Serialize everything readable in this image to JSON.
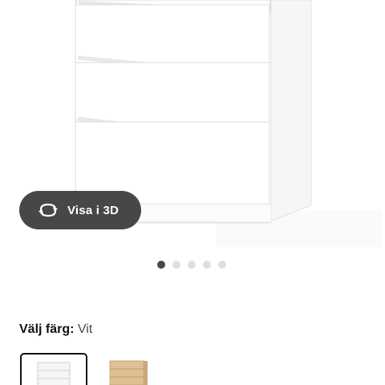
{
  "product": {
    "image_name": "white chest of drawers"
  },
  "view_3d": {
    "label": "Visa i 3D",
    "icon": "rotate-3d-icon"
  },
  "carousel": {
    "count": 5,
    "active_index": 0
  },
  "color_selector": {
    "label": "Välj färg:",
    "selected": "Vit",
    "options": [
      {
        "name": "Vit",
        "color": "#f4f4f4",
        "selected": true
      },
      {
        "name": "Björk",
        "color": "#d8b98a",
        "selected": false
      }
    ]
  }
}
